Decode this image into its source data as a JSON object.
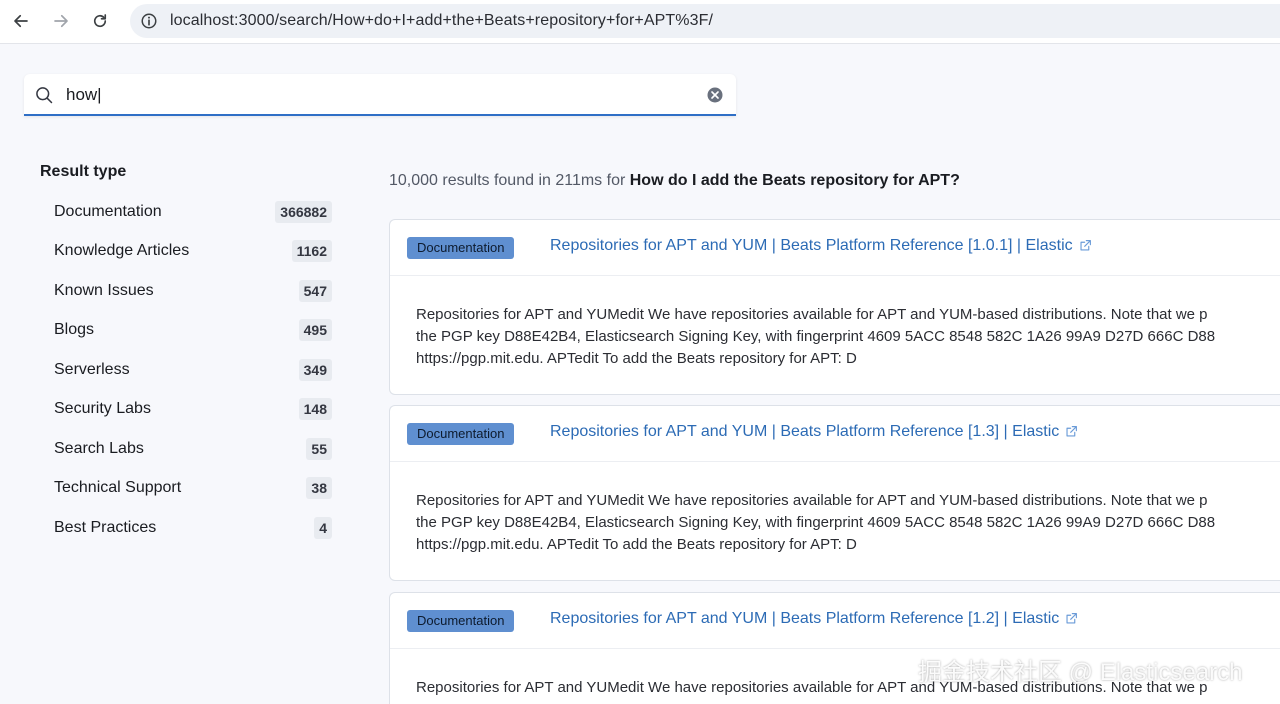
{
  "browser": {
    "url": "localhost:3000/search/How+do+I+add+the+Beats+repository+for+APT%3F/"
  },
  "search": {
    "value": "how|",
    "placeholder": ""
  },
  "sidebar": {
    "title": "Result type",
    "facets": [
      {
        "label": "Documentation",
        "count": "366882"
      },
      {
        "label": "Knowledge Articles",
        "count": "1162"
      },
      {
        "label": "Known Issues",
        "count": "547"
      },
      {
        "label": "Blogs",
        "count": "495"
      },
      {
        "label": "Serverless",
        "count": "349"
      },
      {
        "label": "Security Labs",
        "count": "148"
      },
      {
        "label": "Search Labs",
        "count": "55"
      },
      {
        "label": "Technical Support",
        "count": "38"
      },
      {
        "label": "Best Practices",
        "count": "4"
      }
    ]
  },
  "summary": {
    "text": "10,000 results found in 211ms for ",
    "query": "How do I add the Beats repository for APT?"
  },
  "results": [
    {
      "badge": "Documentation",
      "title": "Repositories for APT and YUM | Beats Platform Reference [1.0.1] | Elastic",
      "snippet": [
        "Repositories for APT and YUMedit We have repositories available for APT and YUM-based distributions. Note that we p",
        "the PGP key D88E42B4, Elasticsearch Signing Key, with fingerprint 4609 5ACC 8548 582C 1A26 99A9 D27D 666C D88",
        "https://pgp.mit.edu. APTedit To add the Beats repository for APT: D"
      ]
    },
    {
      "badge": "Documentation",
      "title": "Repositories for APT and YUM | Beats Platform Reference [1.3] | Elastic",
      "snippet": [
        "Repositories for APT and YUMedit We have repositories available for APT and YUM-based distributions. Note that we p",
        "the PGP key D88E42B4, Elasticsearch Signing Key, with fingerprint 4609 5ACC 8548 582C 1A26 99A9 D27D 666C D88",
        "https://pgp.mit.edu. APTedit To add the Beats repository for APT: D"
      ]
    },
    {
      "badge": "Documentation",
      "title": "Repositories for APT and YUM | Beats Platform Reference [1.2] | Elastic",
      "snippet": [
        "Repositories for APT and YUMedit We have repositories available for APT and YUM-based distributions. Note that we p"
      ]
    }
  ],
  "watermark": "掘金技术社区 @ Elasticsearch",
  "colors": {
    "accent": "#2f6fc6",
    "link": "#2c6bb5",
    "badge": "#5f8fd0"
  },
  "icons": {
    "back": "arrow-left-icon",
    "forward": "arrow-right-icon",
    "reload": "reload-icon",
    "site-info": "info-icon",
    "search": "search-icon",
    "clear": "clear-icon",
    "external": "external-link-icon"
  }
}
